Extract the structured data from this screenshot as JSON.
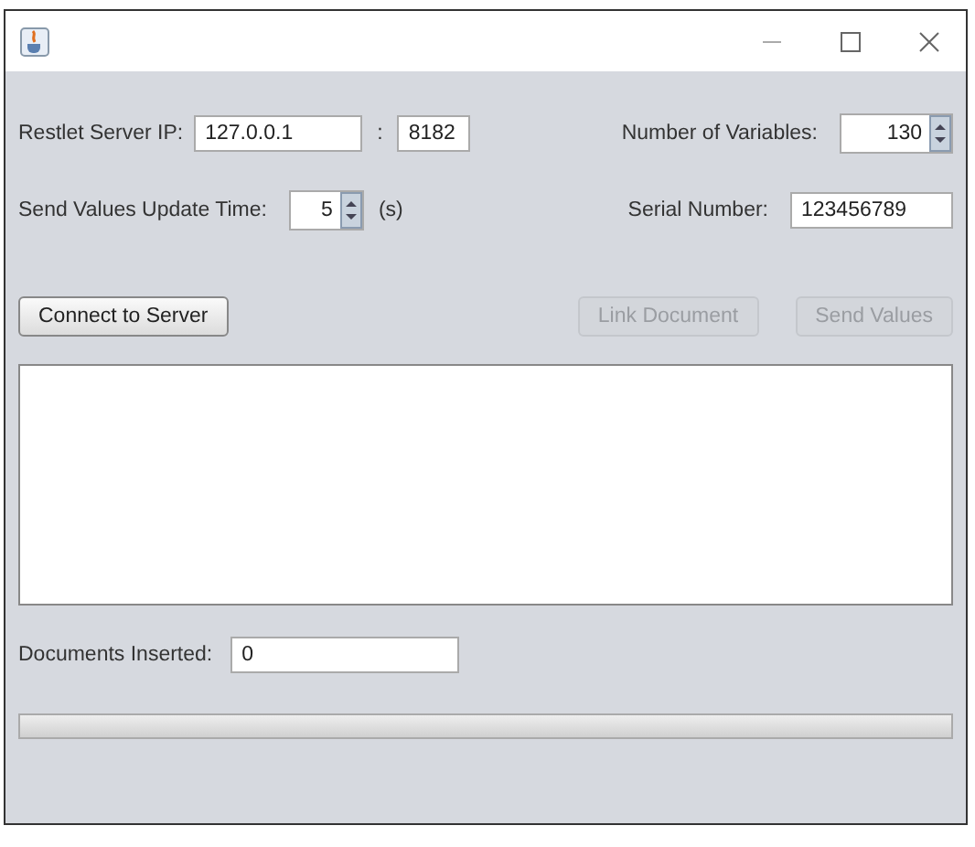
{
  "server": {
    "label": "Restlet Server IP:",
    "ip": "127.0.0.1",
    "separator": ":",
    "port": "8182"
  },
  "variables": {
    "label": "Number of Variables:",
    "value": "130"
  },
  "update_time": {
    "label": "Send Values Update Time:",
    "value": "5",
    "unit": "(s)"
  },
  "serial": {
    "label": "Serial Number:",
    "value": "123456789"
  },
  "buttons": [
    {
      "label": "Connect to Server",
      "disabled": false
    },
    {
      "label": "Link Document",
      "disabled": true
    },
    {
      "label": "Send Values",
      "disabled": true
    }
  ],
  "documents": {
    "label": "Documents Inserted:",
    "value": "0"
  },
  "progress": {
    "level": 0
  }
}
